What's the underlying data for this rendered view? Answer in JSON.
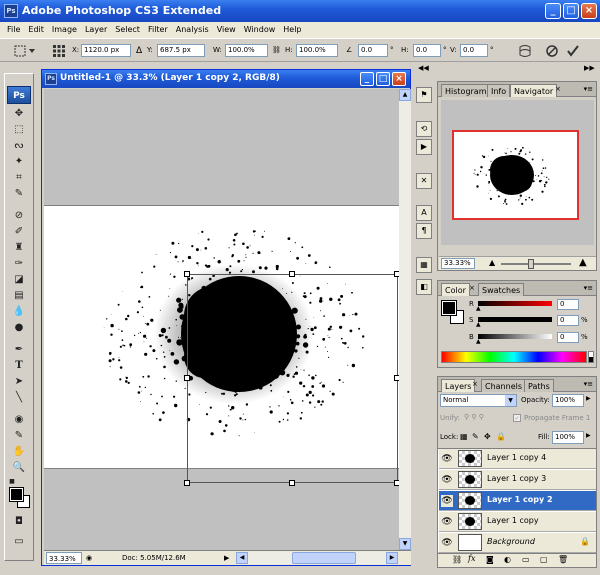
{
  "app": {
    "title": "Adobe Photoshop CS3 Extended",
    "badge": "Ps"
  },
  "menu": [
    "File",
    "Edit",
    "Image",
    "Layer",
    "Select",
    "Filter",
    "Analysis",
    "View",
    "Window",
    "Help"
  ],
  "options": {
    "x_label": "X:",
    "x_value": "1120.0 px",
    "y_label": "Y:",
    "y_value": "687.5 px",
    "w_label": "W:",
    "w_value": "100.0%",
    "h_label": "H:",
    "h_value": "100.0%",
    "rotate_value": "0.0",
    "rotate_unit": "°",
    "hskew_label": "H:",
    "hskew_value": "0.0",
    "vskew_label": "V:",
    "vskew_value": "0.0",
    "deg": "°"
  },
  "document": {
    "title": "Untitled-1 @ 33.3% (Layer 1 copy 2, RGB/8)",
    "zoom": "33.33%",
    "doc_size": "Doc: 5.05M/12.6M"
  },
  "navigator": {
    "tabs": [
      "Histogram",
      "Info",
      "Navigator"
    ],
    "zoom": "33.33%"
  },
  "color": {
    "tabs": [
      "Color",
      "Swatches"
    ],
    "channels": [
      {
        "label": "R",
        "value": "0",
        "unit": ""
      },
      {
        "label": "S",
        "value": "0",
        "unit": "%"
      },
      {
        "label": "B",
        "value": "0",
        "unit": "%"
      }
    ]
  },
  "layers": {
    "tabs": [
      "Layers",
      "Channels",
      "Paths"
    ],
    "blend_mode": "Normal",
    "opacity_label": "Opacity:",
    "opacity_value": "100%",
    "unify_label": "Unify:",
    "propagate_label": "Propagate Frame 1",
    "lock_label": "Lock:",
    "fill_label": "Fill:",
    "fill_value": "100%",
    "items": [
      {
        "name": "Layer 1 copy 4"
      },
      {
        "name": "Layer 1 copy 3"
      },
      {
        "name": "Layer 1 copy 2"
      },
      {
        "name": "Layer 1 copy"
      },
      {
        "name": "Background"
      }
    ]
  },
  "colors": {
    "xp_blue": "#1f5ad8",
    "selected_layer": "#316ac5",
    "nav_frame": "#e03030"
  }
}
